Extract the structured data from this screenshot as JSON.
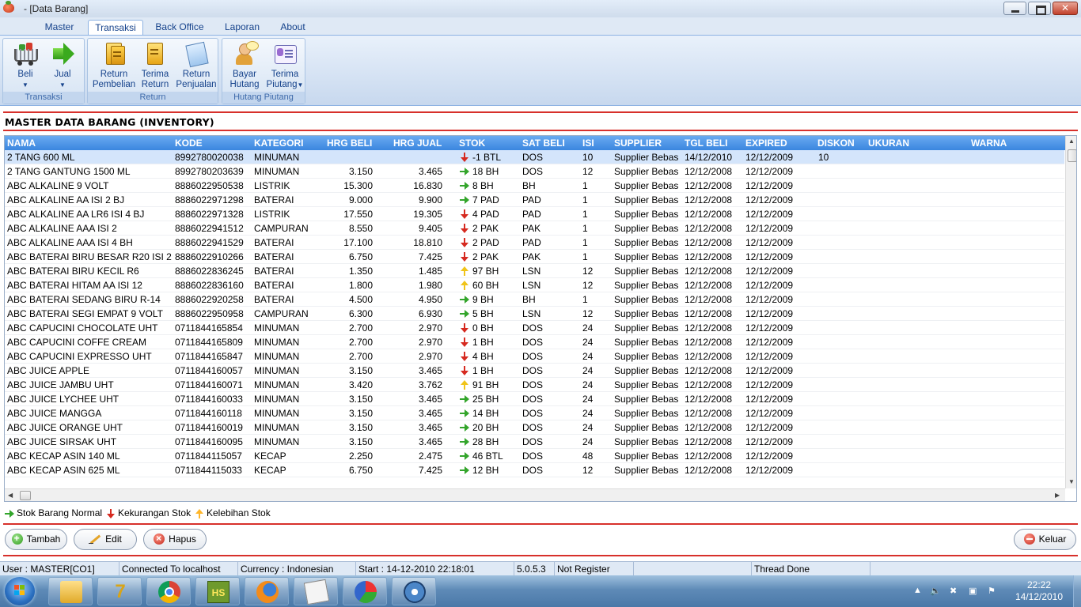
{
  "window": {
    "title": "- [Data Barang]"
  },
  "ribbon": {
    "tabs": [
      "Master",
      "Transaksi",
      "Back Office",
      "Laporan",
      "About"
    ],
    "active_tab": "Transaksi",
    "groups": [
      {
        "label": "Transaksi",
        "buttons": [
          {
            "line1": "Beli",
            "line2": ""
          },
          {
            "line1": "Jual",
            "line2": ""
          }
        ]
      },
      {
        "label": "Return",
        "buttons": [
          {
            "line1": "Return",
            "line2": "Pembelian"
          },
          {
            "line1": "Terima",
            "line2": "Return"
          },
          {
            "line1": "Return",
            "line2": "Penjualan"
          }
        ]
      },
      {
        "label": "Hutang Piutang",
        "buttons": [
          {
            "line1": "Bayar",
            "line2": "Hutang"
          },
          {
            "line1": "Terima",
            "line2": "Piutang"
          }
        ]
      }
    ]
  },
  "page": {
    "heading": "MASTER DATA BARANG (INVENTORY)"
  },
  "table": {
    "columns": [
      "NAMA",
      "KODE",
      "KATEGORI",
      "HRG BELI",
      "HRG JUAL",
      "STOK",
      "SAT BELI",
      "ISI",
      "SUPPLIER",
      "TGL BELI",
      "EXPIRED",
      "DISKON",
      "UKURAN",
      "WARNA"
    ],
    "rows": [
      [
        "2 TANG 600 ML",
        "8992780020038",
        "MINUMAN",
        "",
        "",
        "-1 BTL",
        "DOS",
        "10",
        "Supplier Bebas",
        "14/12/2010",
        "12/12/2009",
        "10",
        "",
        ""
      ],
      [
        "2 TANG GANTUNG 1500 ML",
        "8992780203639",
        "MINUMAN",
        "3.150",
        "3.465",
        "18 BH",
        "DOS",
        "12",
        "Supplier Bebas",
        "12/12/2008",
        "12/12/2009",
        "",
        "",
        ""
      ],
      [
        "ABC ALKALINE 9 VOLT",
        "8886022950538",
        "LISTRIK",
        "15.300",
        "16.830",
        "8 BH",
        "BH",
        "1",
        "Supplier Bebas",
        "12/12/2008",
        "12/12/2009",
        "",
        "",
        ""
      ],
      [
        "ABC ALKALINE AA ISI 2 BJ",
        "8886022971298",
        "BATERAI",
        "9.000",
        "9.900",
        "7 PAD",
        "PAD",
        "1",
        "Supplier Bebas",
        "12/12/2008",
        "12/12/2009",
        "",
        "",
        ""
      ],
      [
        "ABC ALKALINE AA LR6 ISI 4 BJ",
        "8886022971328",
        "LISTRIK",
        "17.550",
        "19.305",
        "4 PAD",
        "PAD",
        "1",
        "Supplier Bebas",
        "12/12/2008",
        "12/12/2009",
        "",
        "",
        ""
      ],
      [
        "ABC ALKALINE AAA ISI 2",
        "8886022941512",
        "CAMPURAN",
        "8.550",
        "9.405",
        "2 PAK",
        "PAK",
        "1",
        "Supplier Bebas",
        "12/12/2008",
        "12/12/2009",
        "",
        "",
        ""
      ],
      [
        "ABC ALKALINE AAA ISI 4 BH",
        "8886022941529",
        "BATERAI",
        "17.100",
        "18.810",
        "2 PAD",
        "PAD",
        "1",
        "Supplier Bebas",
        "12/12/2008",
        "12/12/2009",
        "",
        "",
        ""
      ],
      [
        "ABC BATERAI BIRU BESAR R20 ISI 2",
        "8886022910266",
        "BATERAI",
        "6.750",
        "7.425",
        "2 PAK",
        "PAK",
        "1",
        "Supplier Bebas",
        "12/12/2008",
        "12/12/2009",
        "",
        "",
        ""
      ],
      [
        "ABC BATERAI BIRU KECIL R6",
        "8886022836245",
        "BATERAI",
        "1.350",
        "1.485",
        "97 BH",
        "LSN",
        "12",
        "Supplier Bebas",
        "12/12/2008",
        "12/12/2009",
        "",
        "",
        ""
      ],
      [
        "ABC BATERAI HITAM AA ISI 12",
        "8886022836160",
        "BATERAI",
        "1.800",
        "1.980",
        "60 BH",
        "LSN",
        "12",
        "Supplier Bebas",
        "12/12/2008",
        "12/12/2009",
        "",
        "",
        ""
      ],
      [
        "ABC BATERAI SEDANG BIRU R-14",
        "8886022920258",
        "BATERAI",
        "4.500",
        "4.950",
        "9 BH",
        "BH",
        "1",
        "Supplier Bebas",
        "12/12/2008",
        "12/12/2009",
        "",
        "",
        ""
      ],
      [
        "ABC BATERAI SEGI EMPAT 9 VOLT",
        "8886022950958",
        "CAMPURAN",
        "6.300",
        "6.930",
        "5 BH",
        "LSN",
        "12",
        "Supplier Bebas",
        "12/12/2008",
        "12/12/2009",
        "",
        "",
        ""
      ],
      [
        "ABC CAPUCINI CHOCOLATE UHT",
        "0711844165854",
        "MINUMAN",
        "2.700",
        "2.970",
        "0 BH",
        "DOS",
        "24",
        "Supplier Bebas",
        "12/12/2008",
        "12/12/2009",
        "",
        "",
        ""
      ],
      [
        "ABC CAPUCINI COFFE CREAM",
        "0711844165809",
        "MINUMAN",
        "2.700",
        "2.970",
        "1 BH",
        "DOS",
        "24",
        "Supplier Bebas",
        "12/12/2008",
        "12/12/2009",
        "",
        "",
        ""
      ],
      [
        "ABC CAPUCINI EXPRESSO UHT",
        "0711844165847",
        "MINUMAN",
        "2.700",
        "2.970",
        "4 BH",
        "DOS",
        "24",
        "Supplier Bebas",
        "12/12/2008",
        "12/12/2009",
        "",
        "",
        ""
      ],
      [
        "ABC JUICE APPLE",
        "0711844160057",
        "MINUMAN",
        "3.150",
        "3.465",
        "1 BH",
        "DOS",
        "24",
        "Supplier Bebas",
        "12/12/2008",
        "12/12/2009",
        "",
        "",
        ""
      ],
      [
        "ABC JUICE JAMBU UHT",
        "0711844160071",
        "MINUMAN",
        "3.420",
        "3.762",
        "91 BH",
        "DOS",
        "24",
        "Supplier Bebas",
        "12/12/2008",
        "12/12/2009",
        "",
        "",
        ""
      ],
      [
        "ABC JUICE LYCHEE UHT",
        "0711844160033",
        "MINUMAN",
        "3.150",
        "3.465",
        "25 BH",
        "DOS",
        "24",
        "Supplier Bebas",
        "12/12/2008",
        "12/12/2009",
        "",
        "",
        ""
      ],
      [
        "ABC JUICE MANGGA",
        "0711844160118",
        "MINUMAN",
        "3.150",
        "3.465",
        "14 BH",
        "DOS",
        "24",
        "Supplier Bebas",
        "12/12/2008",
        "12/12/2009",
        "",
        "",
        ""
      ],
      [
        "ABC JUICE ORANGE UHT",
        "0711844160019",
        "MINUMAN",
        "3.150",
        "3.465",
        "20 BH",
        "DOS",
        "24",
        "Supplier Bebas",
        "12/12/2008",
        "12/12/2009",
        "",
        "",
        ""
      ],
      [
        "ABC JUICE SIRSAK UHT",
        "0711844160095",
        "MINUMAN",
        "3.150",
        "3.465",
        "28 BH",
        "DOS",
        "24",
        "Supplier Bebas",
        "12/12/2008",
        "12/12/2009",
        "",
        "",
        ""
      ],
      [
        "ABC KECAP ASIN 140 ML",
        "0711844115057",
        "KECAP",
        "2.250",
        "2.475",
        "46 BTL",
        "DOS",
        "48",
        "Supplier Bebas",
        "12/12/2008",
        "12/12/2009",
        "",
        "",
        ""
      ],
      [
        "ABC KECAP ASIN 625 ML",
        "0711844115033",
        "KECAP",
        "6.750",
        "7.425",
        "12 BH",
        "DOS",
        "12",
        "Supplier Bebas",
        "12/12/2008",
        "12/12/2009",
        "",
        "",
        ""
      ]
    ],
    "stock_status": [
      "down",
      "right",
      "right",
      "right",
      "down",
      "down",
      "down",
      "down",
      "up",
      "up",
      "right",
      "right",
      "down",
      "down",
      "down",
      "down",
      "up",
      "right",
      "right",
      "right",
      "right",
      "right",
      "right"
    ],
    "status_colors": {
      "right": "#33a52b",
      "down": "#d62a20",
      "up": "#f0c419"
    }
  },
  "legend": {
    "normal": "Stok Barang Normal",
    "kurang": "Kekurangan Stok",
    "lebih": "Kelebihan Stok"
  },
  "buttons": {
    "tambah": "Tambah",
    "edit": "Edit",
    "hapus": "Hapus",
    "keluar": "Keluar"
  },
  "status_bar": {
    "user": "User : MASTER[CO1]",
    "connection": "Connected To localhost",
    "currency": "Currency : Indonesian",
    "start": "Start  : 14-12-2010 22:18:01",
    "version": "5.0.5.3",
    "register": "Not Register",
    "empty": "",
    "thread": "Thread Done"
  },
  "taskbar": {
    "time": "22:22",
    "date": "14/12/2010",
    "apps": [
      "explorer-icon",
      "seven-app-icon",
      "chrome-icon",
      "hs-app-icon",
      "firefox-icon",
      "mail-icon",
      "pie-app-icon",
      "media-player-icon"
    ]
  }
}
